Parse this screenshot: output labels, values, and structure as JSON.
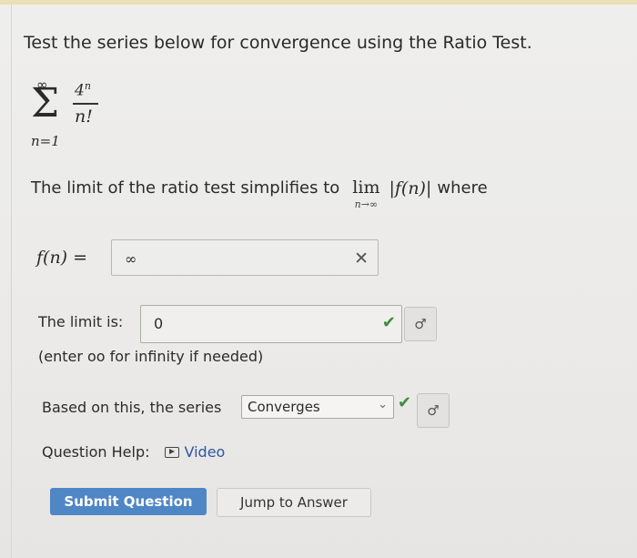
{
  "question": {
    "prompt": "Test the series below for convergence using the Ratio Test.",
    "series": {
      "upper_limit": "∞",
      "lower_limit": "n=1",
      "numerator_base": "4",
      "numerator_exp": "n",
      "denominator": "n!"
    },
    "limit_text": "The limit of the ratio test simplifies to",
    "lim_word": "lim",
    "lim_sub": "n→∞",
    "abs_expr": "|f(n)|",
    "where_word": "where"
  },
  "fn_field": {
    "label": "f(n) =",
    "value": "∞",
    "status_icon": "x-mark",
    "status_glyph": "✕"
  },
  "limit_field": {
    "label": "The limit is:",
    "value": "0",
    "hint": "(enter oo for infinity if needed)",
    "status_icon": "check-mark",
    "status_glyph": "✔"
  },
  "conclusion": {
    "label": "Based on this, the series",
    "selected": "Converges",
    "chevron": "⌄",
    "status_glyph": "✔"
  },
  "key_glyph": "♂",
  "help": {
    "label": "Question Help:",
    "video_label": "Video"
  },
  "buttons": {
    "submit": "Submit Question",
    "jump": "Jump to Answer"
  },
  "colors": {
    "submit_bg": "#4f86c6",
    "check_green": "#3e8c3a",
    "link_blue": "#2f56a3"
  }
}
